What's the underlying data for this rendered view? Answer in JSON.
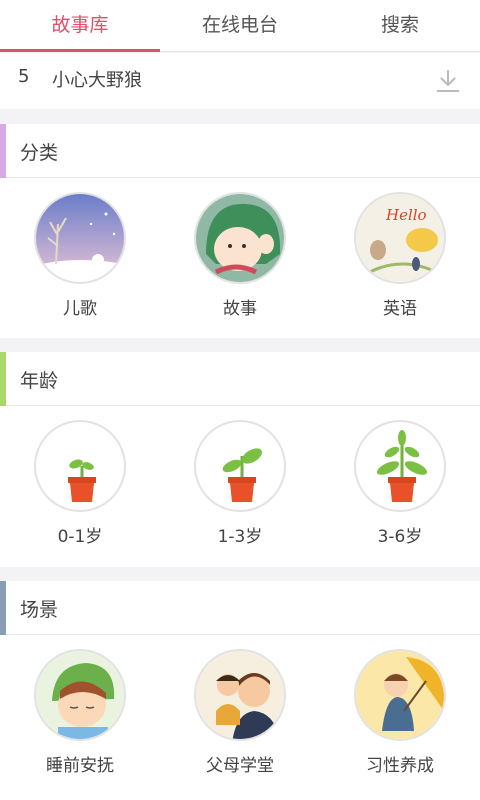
{
  "tabs": [
    {
      "label": "故事库",
      "active": true
    },
    {
      "label": "在线电台",
      "active": false
    },
    {
      "label": "搜索",
      "active": false
    }
  ],
  "track": {
    "number": "5",
    "title": "小心大野狼",
    "icon": "download-icon"
  },
  "sections": [
    {
      "title": "分类",
      "accent": "#d7a8e6",
      "items": [
        {
          "label": "儿歌",
          "icon": "nursery-rhyme-image"
        },
        {
          "label": "故事",
          "icon": "story-image"
        },
        {
          "label": "英语",
          "icon": "english-image"
        }
      ]
    },
    {
      "title": "年龄",
      "accent": "#a9d96a",
      "items": [
        {
          "label": "0-1岁",
          "icon": "sprout-small-icon"
        },
        {
          "label": "1-3岁",
          "icon": "sprout-medium-icon"
        },
        {
          "label": "3-6岁",
          "icon": "sprout-large-icon"
        }
      ]
    },
    {
      "title": "场景",
      "accent": "#8a9db3",
      "items": [
        {
          "label": "睡前安抚",
          "icon": "bedtime-image"
        },
        {
          "label": "父母学堂",
          "icon": "parent-school-image"
        },
        {
          "label": "习性养成",
          "icon": "habit-image"
        }
      ]
    }
  ],
  "colors": {
    "accent": "#e0506a",
    "pot": "#e8522a",
    "leaf": "#7cc043"
  }
}
